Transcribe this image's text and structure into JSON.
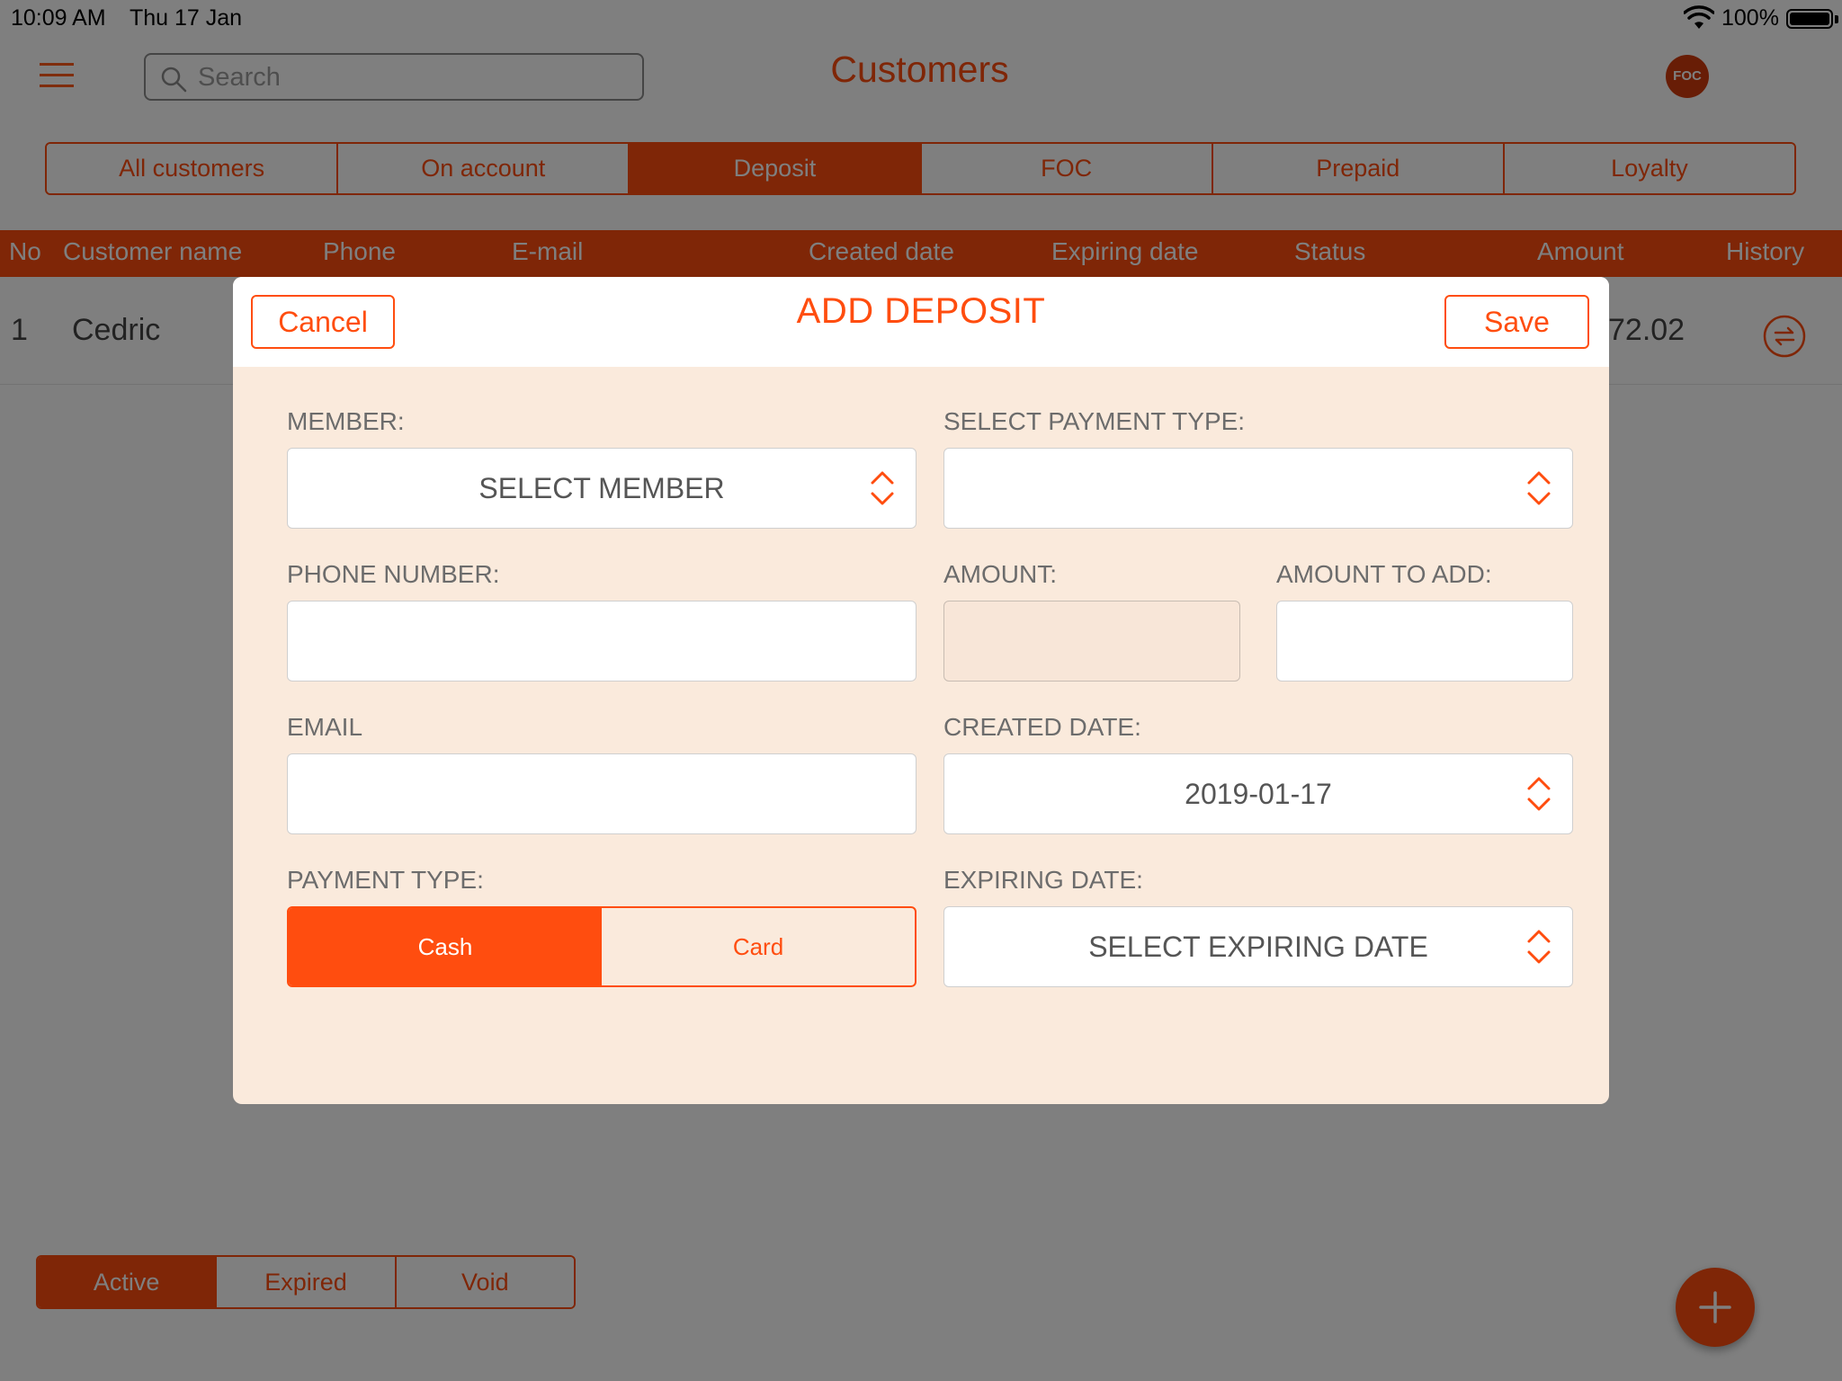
{
  "status_bar": {
    "time": "10:09 AM",
    "date": "Thu 17 Jan",
    "battery": "100%"
  },
  "header": {
    "title": "Customers",
    "search": {
      "placeholder": "Search",
      "value": ""
    },
    "badge": "FOC"
  },
  "tabs": [
    {
      "label": "All customers",
      "active": false
    },
    {
      "label": "On account",
      "active": false
    },
    {
      "label": "Deposit",
      "active": true
    },
    {
      "label": "FOC",
      "active": false
    },
    {
      "label": "Prepaid",
      "active": false
    },
    {
      "label": "Loyalty",
      "active": false
    }
  ],
  "table": {
    "columns": [
      "No",
      "Customer name",
      "Phone",
      "E-mail",
      "Created date",
      "Expiring date",
      "Status",
      "Amount",
      "History"
    ],
    "rows": [
      {
        "no": "1",
        "name": "Cedric",
        "amount": "72.02"
      }
    ]
  },
  "status_filter": [
    {
      "label": "Active",
      "active": true
    },
    {
      "label": "Expired",
      "active": false
    },
    {
      "label": "Void",
      "active": false
    }
  ],
  "modal": {
    "title": "ADD DEPOSIT",
    "cancel": "Cancel",
    "save": "Save",
    "member": {
      "label": "MEMBER:",
      "value": "SELECT MEMBER"
    },
    "payment_select": {
      "label": "SELECT PAYMENT TYPE:",
      "value": ""
    },
    "phone": {
      "label": "PHONE NUMBER:",
      "value": ""
    },
    "amount": {
      "label": "AMOUNT:",
      "value": ""
    },
    "amount_to_add": {
      "label": "AMOUNT TO ADD:",
      "value": ""
    },
    "email": {
      "label": "EMAIL",
      "value": ""
    },
    "created_date": {
      "label": "CREATED DATE:",
      "value": "2019-01-17"
    },
    "payment_type": {
      "label": "PAYMENT TYPE:",
      "options": [
        "Cash",
        "Card"
      ],
      "selected": "Cash"
    },
    "expiring_date": {
      "label": "EXPIRING DATE:",
      "value": "SELECT EXPIRING DATE"
    }
  },
  "colors": {
    "accent": "#ff4d0f",
    "modal_bg": "#faeadc",
    "overlay": "rgba(0,0,0,0.5)"
  }
}
